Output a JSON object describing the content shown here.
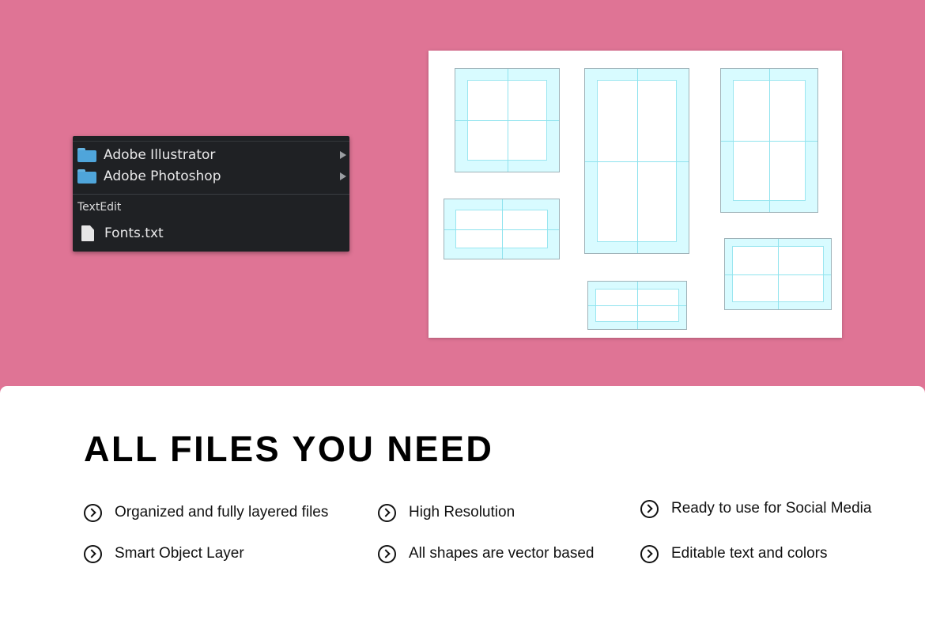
{
  "menu": {
    "items": [
      {
        "label": "Adobe Illustrator",
        "icon": "folder-icon",
        "has_submenu": true
      },
      {
        "label": "Adobe Photoshop",
        "icon": "folder-icon",
        "has_submenu": true
      }
    ],
    "section_label": "TextEdit",
    "file": {
      "label": "Fonts.txt",
      "icon": "text-file-icon"
    }
  },
  "panel": {
    "headline": "ALL FILES YOU NEED",
    "features": [
      {
        "label": "Organized and fully layered files",
        "icon": "chevron-circle-icon"
      },
      {
        "label": "High Resolution",
        "icon": "chevron-circle-icon"
      },
      {
        "label": "Ready to use for Social Media",
        "icon": "chevron-circle-icon"
      },
      {
        "label": "Smart Object Layer",
        "icon": "chevron-circle-icon"
      },
      {
        "label": "All shapes are vector based",
        "icon": "chevron-circle-icon"
      },
      {
        "label": "Editable text and colors",
        "icon": "chevron-circle-icon"
      }
    ]
  },
  "colors": {
    "background": "#df7495",
    "menu_bg": "#1f2124",
    "folder_blue": "#4fa5da",
    "guide_cyan": "#d8fbff"
  }
}
